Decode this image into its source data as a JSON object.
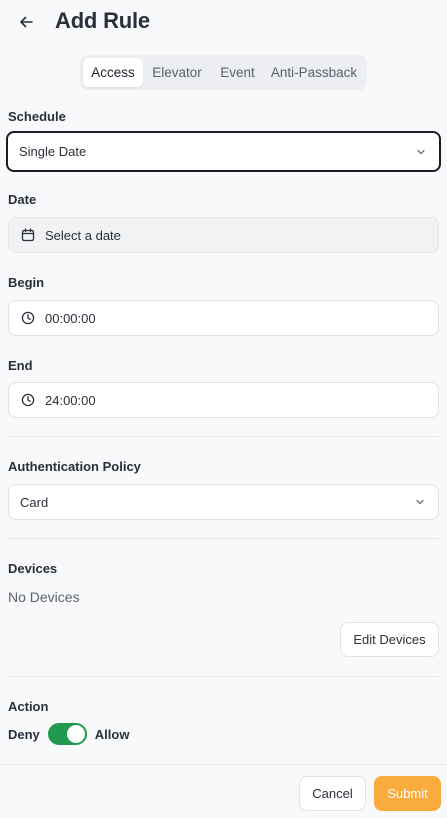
{
  "header": {
    "title": "Add Rule",
    "back_icon": "arrow-left-icon"
  },
  "tabs": [
    {
      "label": "Access",
      "active": true
    },
    {
      "label": "Elevator",
      "active": false
    },
    {
      "label": "Event",
      "active": false
    },
    {
      "label": "Anti-Passback",
      "active": false
    }
  ],
  "schedule": {
    "label": "Schedule",
    "value": "Single Date"
  },
  "date": {
    "label": "Date",
    "placeholder": "Select a date",
    "icon": "calendar-icon"
  },
  "begin": {
    "label": "Begin",
    "value": "00:00:00",
    "icon": "clock-icon"
  },
  "end": {
    "label": "End",
    "value": "24:00:00",
    "icon": "clock-icon"
  },
  "auth_policy": {
    "label": "Authentication Policy",
    "value": "Card"
  },
  "devices": {
    "label": "Devices",
    "empty_text": "No Devices",
    "edit_button": "Edit Devices"
  },
  "action": {
    "label": "Action",
    "off_label": "Deny",
    "on_label": "Allow",
    "enabled": true
  },
  "footer": {
    "cancel": "Cancel",
    "submit": "Submit"
  },
  "colors": {
    "accent": "#f9ab3b",
    "toggle_on": "#1f9a4f"
  }
}
